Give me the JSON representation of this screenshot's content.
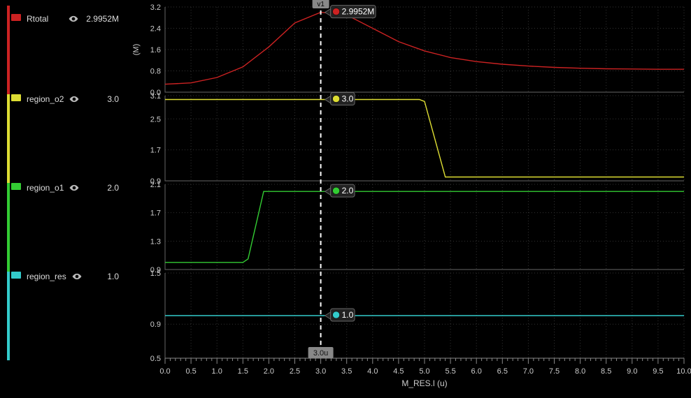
{
  "sidebar": {
    "series": [
      {
        "name": "Rtotal",
        "color": "#cc2222",
        "value": "2.9952M"
      },
      {
        "name": "region_o2",
        "color": "#dddd33",
        "value": "3.0"
      },
      {
        "name": "region_o1",
        "color": "#33cc33",
        "value": "2.0"
      },
      {
        "name": "region_res",
        "color": "#33cccc",
        "value": "1.0"
      }
    ]
  },
  "cursor": {
    "name": "v1",
    "x_label": "3.0u",
    "x_value": 3.0
  },
  "x_axis": {
    "label": "M_RES.l (u)",
    "min": 0.0,
    "max": 10.0,
    "ticks": [
      "0.0",
      "0.5",
      "1.0",
      "1.5",
      "2.0",
      "2.5",
      "3.0",
      "3.5",
      "4.0",
      "4.5",
      "5.0",
      "5.5",
      "6.0",
      "6.5",
      "7.0",
      "7.5",
      "8.0",
      "8.5",
      "9.0",
      "9.5",
      "10.0"
    ]
  },
  "panes": [
    {
      "id": "rtotal",
      "ylabel": "(M)",
      "ymin": 0.0,
      "ymax": 3.2,
      "yticks": [
        "0.0",
        "0.8",
        "1.6",
        "2.4",
        "3.2"
      ],
      "marker": {
        "value": "2.9952M",
        "color": "#cc2222"
      }
    },
    {
      "id": "o2",
      "ylabel": "",
      "ymin": 0.9,
      "ymax": 3.1,
      "yticks": [
        "0.9",
        "1.7",
        "2.5",
        "3.1"
      ],
      "marker": {
        "value": "3.0",
        "color": "#dddd33"
      }
    },
    {
      "id": "o1",
      "ylabel": "",
      "ymin": 0.9,
      "ymax": 2.1,
      "yticks": [
        "0.9",
        "1.3",
        "1.7",
        "2.1"
      ],
      "marker": {
        "value": "2.0",
        "color": "#33cc33"
      }
    },
    {
      "id": "res",
      "ylabel": "",
      "ymin": 0.5,
      "ymax": 1.5,
      "yticks": [
        "0.5",
        "0.9",
        "1.5"
      ],
      "marker": {
        "value": "1.0",
        "color": "#33cccc"
      }
    }
  ],
  "chart_data": [
    {
      "type": "line",
      "title": "Rtotal",
      "xlabel": "M_RES.l (u)",
      "ylabel": "(M)",
      "ylim": [
        0.0,
        3.2
      ],
      "x": [
        0.0,
        0.5,
        1.0,
        1.5,
        2.0,
        2.5,
        3.0,
        3.5,
        4.0,
        4.5,
        5.0,
        5.5,
        6.0,
        6.5,
        7.0,
        7.5,
        8.0,
        8.5,
        9.0,
        9.5,
        10.0
      ],
      "values": [
        0.3,
        0.35,
        0.55,
        0.95,
        1.7,
        2.6,
        3.0,
        2.9,
        2.4,
        1.9,
        1.55,
        1.3,
        1.15,
        1.05,
        0.98,
        0.93,
        0.9,
        0.88,
        0.87,
        0.86,
        0.86
      ],
      "series_name": "Rtotal",
      "color": "#cc2222"
    },
    {
      "type": "line",
      "title": "region_o2",
      "xlabel": "M_RES.l (u)",
      "ylabel": "",
      "ylim": [
        0.9,
        3.1
      ],
      "x": [
        0.0,
        4.9,
        5.0,
        5.4,
        10.0
      ],
      "values": [
        3.0,
        3.0,
        2.95,
        1.0,
        1.0
      ],
      "series_name": "region_o2",
      "color": "#dddd33"
    },
    {
      "type": "line",
      "title": "region_o1",
      "xlabel": "M_RES.l (u)",
      "ylabel": "",
      "ylim": [
        0.9,
        2.1
      ],
      "x": [
        0.0,
        1.5,
        1.6,
        1.9,
        10.0
      ],
      "values": [
        1.0,
        1.0,
        1.05,
        2.0,
        2.0
      ],
      "series_name": "region_o1",
      "color": "#33cc33"
    },
    {
      "type": "line",
      "title": "region_res",
      "xlabel": "M_RES.l (u)",
      "ylabel": "",
      "ylim": [
        0.5,
        1.5
      ],
      "x": [
        0.0,
        10.0
      ],
      "values": [
        1.0,
        1.0
      ],
      "series_name": "region_res",
      "color": "#33cccc"
    }
  ]
}
